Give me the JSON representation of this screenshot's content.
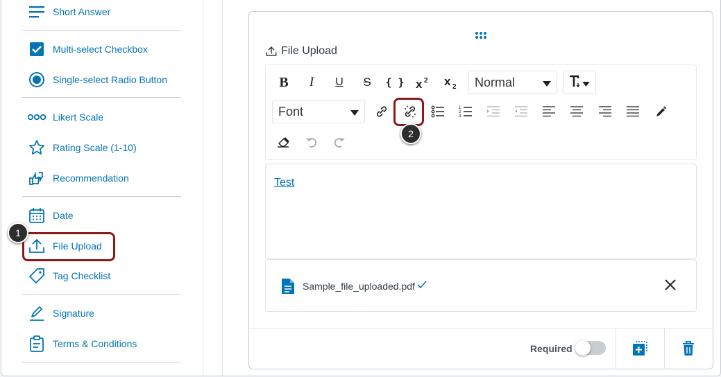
{
  "sidebar": {
    "items": [
      {
        "label": "Short Answer"
      },
      {
        "label": "Multi-select Checkbox"
      },
      {
        "label": "Single-select Radio Button"
      },
      {
        "label": "Likert Scale"
      },
      {
        "label": "Rating Scale (1-10)"
      },
      {
        "label": "Recommendation"
      },
      {
        "label": "Date"
      },
      {
        "label": "File Upload"
      },
      {
        "label": "Tag Checklist"
      },
      {
        "label": "Signature"
      },
      {
        "label": "Terms & Conditions"
      }
    ]
  },
  "callouts": {
    "one": "1",
    "two": "2"
  },
  "card": {
    "title": "File Upload",
    "toolbar": {
      "paragraph_style": "Normal",
      "font": "Font",
      "bold": "B",
      "italic": "I",
      "underline": "U",
      "strike": "S",
      "code": "{ }"
    },
    "editor": {
      "link_text": "Test"
    },
    "file": {
      "name": "Sample_file_uploaded.pdf"
    },
    "footer": {
      "required_label": "Required"
    }
  },
  "colors": {
    "accent": "#0374b5",
    "highlight": "#8b1a1a"
  }
}
